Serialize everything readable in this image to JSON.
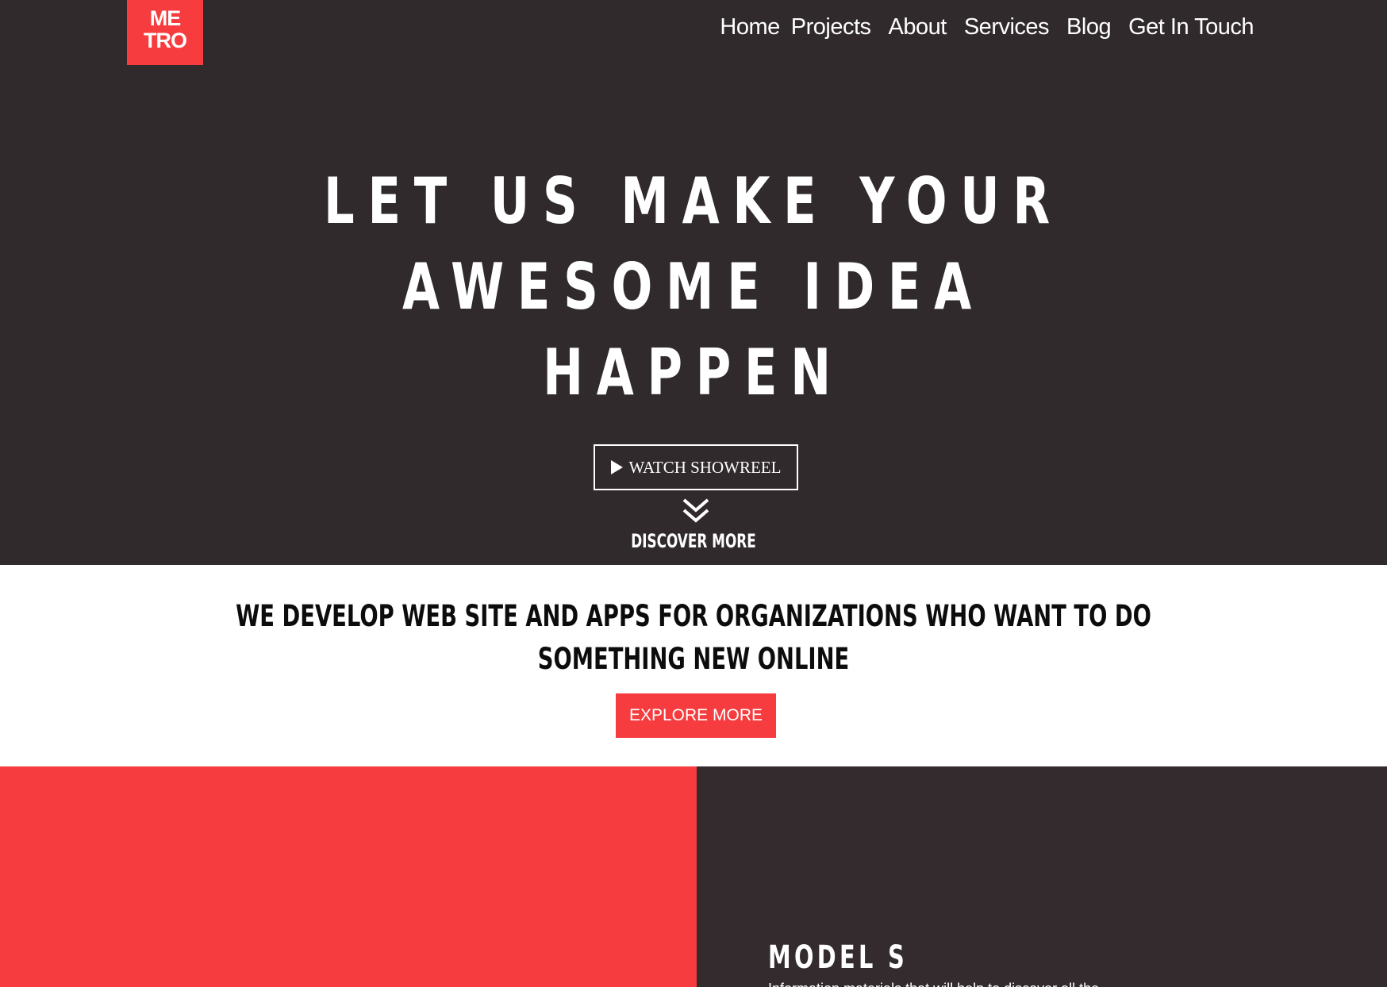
{
  "brand": {
    "logo_line1": "ME",
    "logo_line2": "TRO",
    "accent_color": "#f63c3f",
    "dark_color": "#312a2d"
  },
  "nav": {
    "items": [
      "Home",
      "Projects",
      "About",
      "Services",
      "Blog",
      "Get In Touch"
    ]
  },
  "hero": {
    "headline_lines": [
      "LET US MAKE YOUR",
      "AWESOME IDEA",
      "HAPPEN"
    ],
    "showreel_label": "WATCH SHOWREEL",
    "showreel_icon": "play-icon",
    "discover_icon": "double-chevron-down-icon",
    "discover_label": "DISCOVER MORE"
  },
  "intro": {
    "lines": [
      "WE DEVELOP WEB SITE AND APPS FOR ORGANIZATIONS WHO WANT TO DO",
      "SOMETHING NEW ONLINE"
    ],
    "explore_label": "EXPLORE MORE"
  },
  "feature": {
    "title": "MODEL S",
    "description": "Information materials that will help to discover all the"
  }
}
